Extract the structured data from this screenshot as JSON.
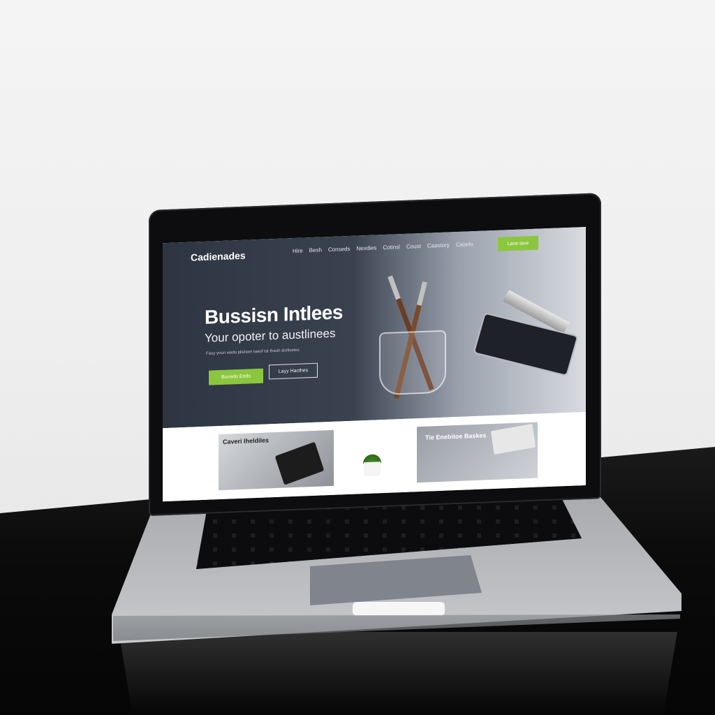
{
  "site": {
    "logo_text": "Cadienades",
    "nav": [
      "Hire",
      "Besh",
      "Conseds",
      "Nexdies",
      "Cotinsl",
      "Coust",
      "Caastory",
      "Caselo"
    ],
    "nav_cta": "Lane tave",
    "hero": {
      "headline": "Bussisn Intlees",
      "subhead": "Your opoter to austlinees",
      "small_text": "Fauy youn wadu plisham taaof tat thaoh dorlicetes",
      "primary_button": "Bucedo Ends",
      "secondary_button": "Layy Hacthes"
    },
    "cards": [
      {
        "label": "Caveri Iheldiles"
      },
      {
        "label": ""
      },
      {
        "label": "Tie Enebitoe Baskes"
      }
    ]
  },
  "colors": {
    "accent": "#8cc63f",
    "hero_dark": "#2e3542",
    "desk": "#0b0b0b",
    "laptop_aluminum": "#b9bbbf"
  },
  "icons": {
    "nav_caret": "chevron-down-icon"
  }
}
